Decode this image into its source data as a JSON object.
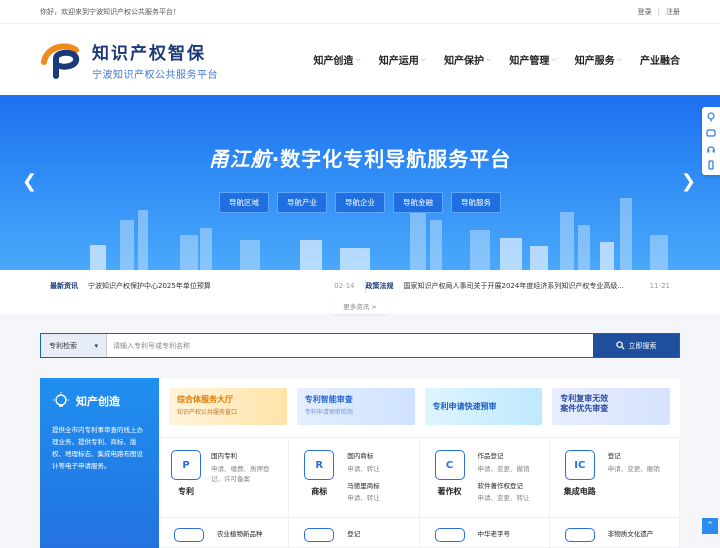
{
  "topbar": {
    "welcome": "你好，欢迎来到宁波知识产权公共服务平台！",
    "login": "登录",
    "sep": "|",
    "register": "注册"
  },
  "brand": {
    "name": "知识产权智保",
    "subtitle": "宁波知识产权公共服务平台"
  },
  "nav": [
    {
      "label": "知产创造"
    },
    {
      "label": "知产运用"
    },
    {
      "label": "知产保护"
    },
    {
      "label": "知产管理"
    },
    {
      "label": "知产服务"
    },
    {
      "label": "产业融合"
    }
  ],
  "banner": {
    "title_em": "甬江航",
    "title_rest": "·数字化专利导航服务平台",
    "tags": [
      "导航区域",
      "导航产业",
      "导航企业",
      "导航金融",
      "导航服务"
    ]
  },
  "news": [
    {
      "label": "最新资讯",
      "text": "宁波知识产权保护中心2025年单位预算",
      "date": "02-14"
    },
    {
      "label": "政策法规",
      "text": "国家知识产权局人事司关于开展2024年度经济系列知识产权专业高级...",
      "date": "11-21"
    }
  ],
  "more_news": "更多资讯 >",
  "search": {
    "select": "专利检索",
    "placeholder": "请输入专利号或专利名称",
    "button": "立即搜索"
  },
  "creation": {
    "title": "知产创造",
    "desc": "提供全市内专利事审查的线上办理业务，提供专利、商标、版权、地理标志、集成电路布图设计等电子申请服务。"
  },
  "promos": [
    {
      "title": "综合体服务大厅",
      "sub": "知识产权公共服务窗口"
    },
    {
      "title": "专利智能审查",
      "sub": "专利申请预审检测"
    },
    {
      "title": "专利申请快速预审",
      "sub": ""
    },
    {
      "title": "专利复审无效",
      "title2": "案件优先审查",
      "sub": ""
    }
  ],
  "services": [
    {
      "name": "专利",
      "icon": "P",
      "h": "国内专利",
      "l": "申请、缴费、质押登记、许可备案"
    },
    {
      "name": "商标",
      "icon": "R",
      "h": "国内商标",
      "l": "申请、转让",
      "h2": "马德里商标",
      "l2": "申请、转让"
    },
    {
      "name": "著作权",
      "icon": "C",
      "h": "作品登记",
      "l": "申请、变更、撤销",
      "h2": "软件著作权登记",
      "l2": "申请、变更、转让"
    },
    {
      "name": "集成电路",
      "icon": "IC",
      "h": "登记",
      "l": "申请、变更、撤销"
    }
  ],
  "services_row2": [
    {
      "h": "农业植物新品种"
    },
    {
      "h": "登记"
    },
    {
      "h": "中华老字号"
    },
    {
      "h": "非物质文化遗产"
    }
  ]
}
